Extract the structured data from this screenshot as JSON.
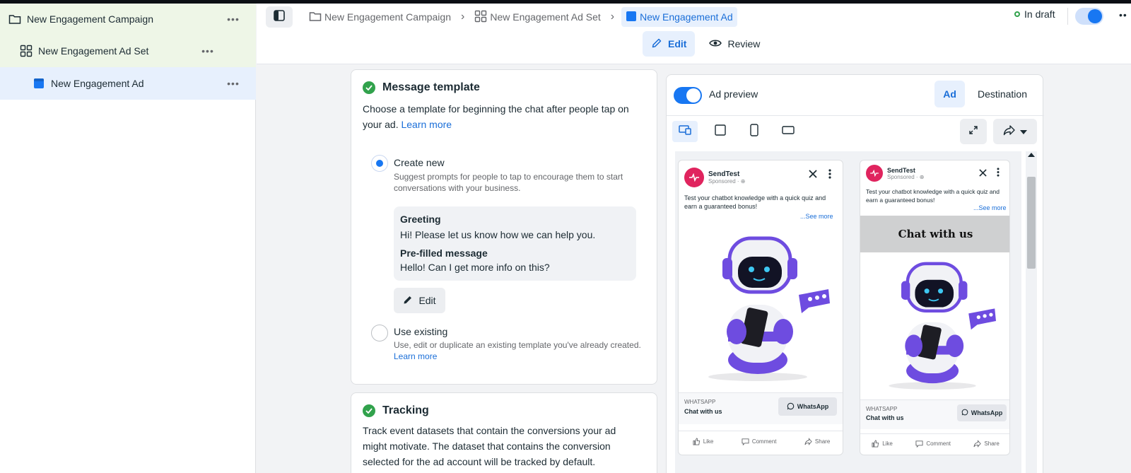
{
  "sidebar": {
    "campaign": {
      "label": "New Engagement Campaign",
      "more": "•••"
    },
    "adset": {
      "label": "New Engagement Ad Set",
      "more": "•••"
    },
    "ad": {
      "label": "New Engagement Ad",
      "more": "•••"
    }
  },
  "breadcrumb": {
    "campaign": "New Engagement Campaign",
    "adset": "New Engagement Ad Set",
    "ad": "New Engagement Ad",
    "separator": "›"
  },
  "status": {
    "label": "In draft",
    "more": "••"
  },
  "mode_tabs": {
    "edit": "Edit",
    "review": "Review"
  },
  "message_template": {
    "title": "Message template",
    "description": "Choose a template for beginning the chat after people tap on your ad.",
    "learn_more": "Learn more",
    "create_new": {
      "title": "Create new",
      "description": "Suggest prompts for people to tap to encourage them to start conversations with your business."
    },
    "greeting_label": "Greeting",
    "greeting_value": "Hi! Please let us know how we can help you.",
    "prefilled_label": "Pre-filled message",
    "prefilled_value": "Hello! Can I get more info on this?",
    "edit_label": "Edit",
    "use_existing": {
      "title": "Use existing",
      "description": "Use, edit or duplicate an existing template you've already created.",
      "learn_more": "Learn more"
    }
  },
  "tracking": {
    "title": "Tracking",
    "description": "Track event datasets that contain the conversions your ad might motivate. The dataset that contains the conversion selected for the ad account will be tracked by default."
  },
  "preview": {
    "label": "Ad preview",
    "tabs": {
      "ad": "Ad",
      "destination": "Destination"
    },
    "ads": [
      {
        "page_name": "SendTest",
        "sponsored": "Sponsored · ⊕",
        "text": "Test your chatbot knowledge with a quick quiz and earn a guaranteed bonus!",
        "see_more": "...See more",
        "platform": "WHATSAPP",
        "cta_text": "Chat with us",
        "button": "WhatsApp",
        "actions": {
          "like": "Like",
          "comment": "Comment",
          "share": "Share"
        }
      },
      {
        "page_name": "SendTest",
        "sponsored": "Sponsored · ⊕",
        "text": "Test your chatbot knowledge with a quick quiz and earn a guaranteed bonus!",
        "see_more": "...See more",
        "banner": "Chat with us",
        "platform": "WHATSAPP",
        "cta_text": "Chat with us",
        "button": "WhatsApp",
        "actions": {
          "like": "Like",
          "comment": "Comment",
          "share": "Share"
        }
      }
    ]
  },
  "colors": {
    "accent": "#1877f2",
    "link": "#1a6ed8",
    "success": "#31a24c",
    "draft_green": "#31a24c",
    "bot_purple": "#6e4ce0"
  },
  "icons": [
    "folder-icon",
    "grid-icon",
    "ad-square-icon",
    "panel-toggle-icon",
    "pencil-icon",
    "eye-icon",
    "desktop-mobile-icon",
    "square-icon",
    "phone-icon",
    "landscape-icon",
    "expand-icon",
    "share-icon",
    "caret-down-icon",
    "check-circle-icon",
    "close-icon",
    "kebab-icon",
    "whatsapp-icon",
    "like-icon",
    "comment-icon",
    "share-arrow-icon"
  ]
}
